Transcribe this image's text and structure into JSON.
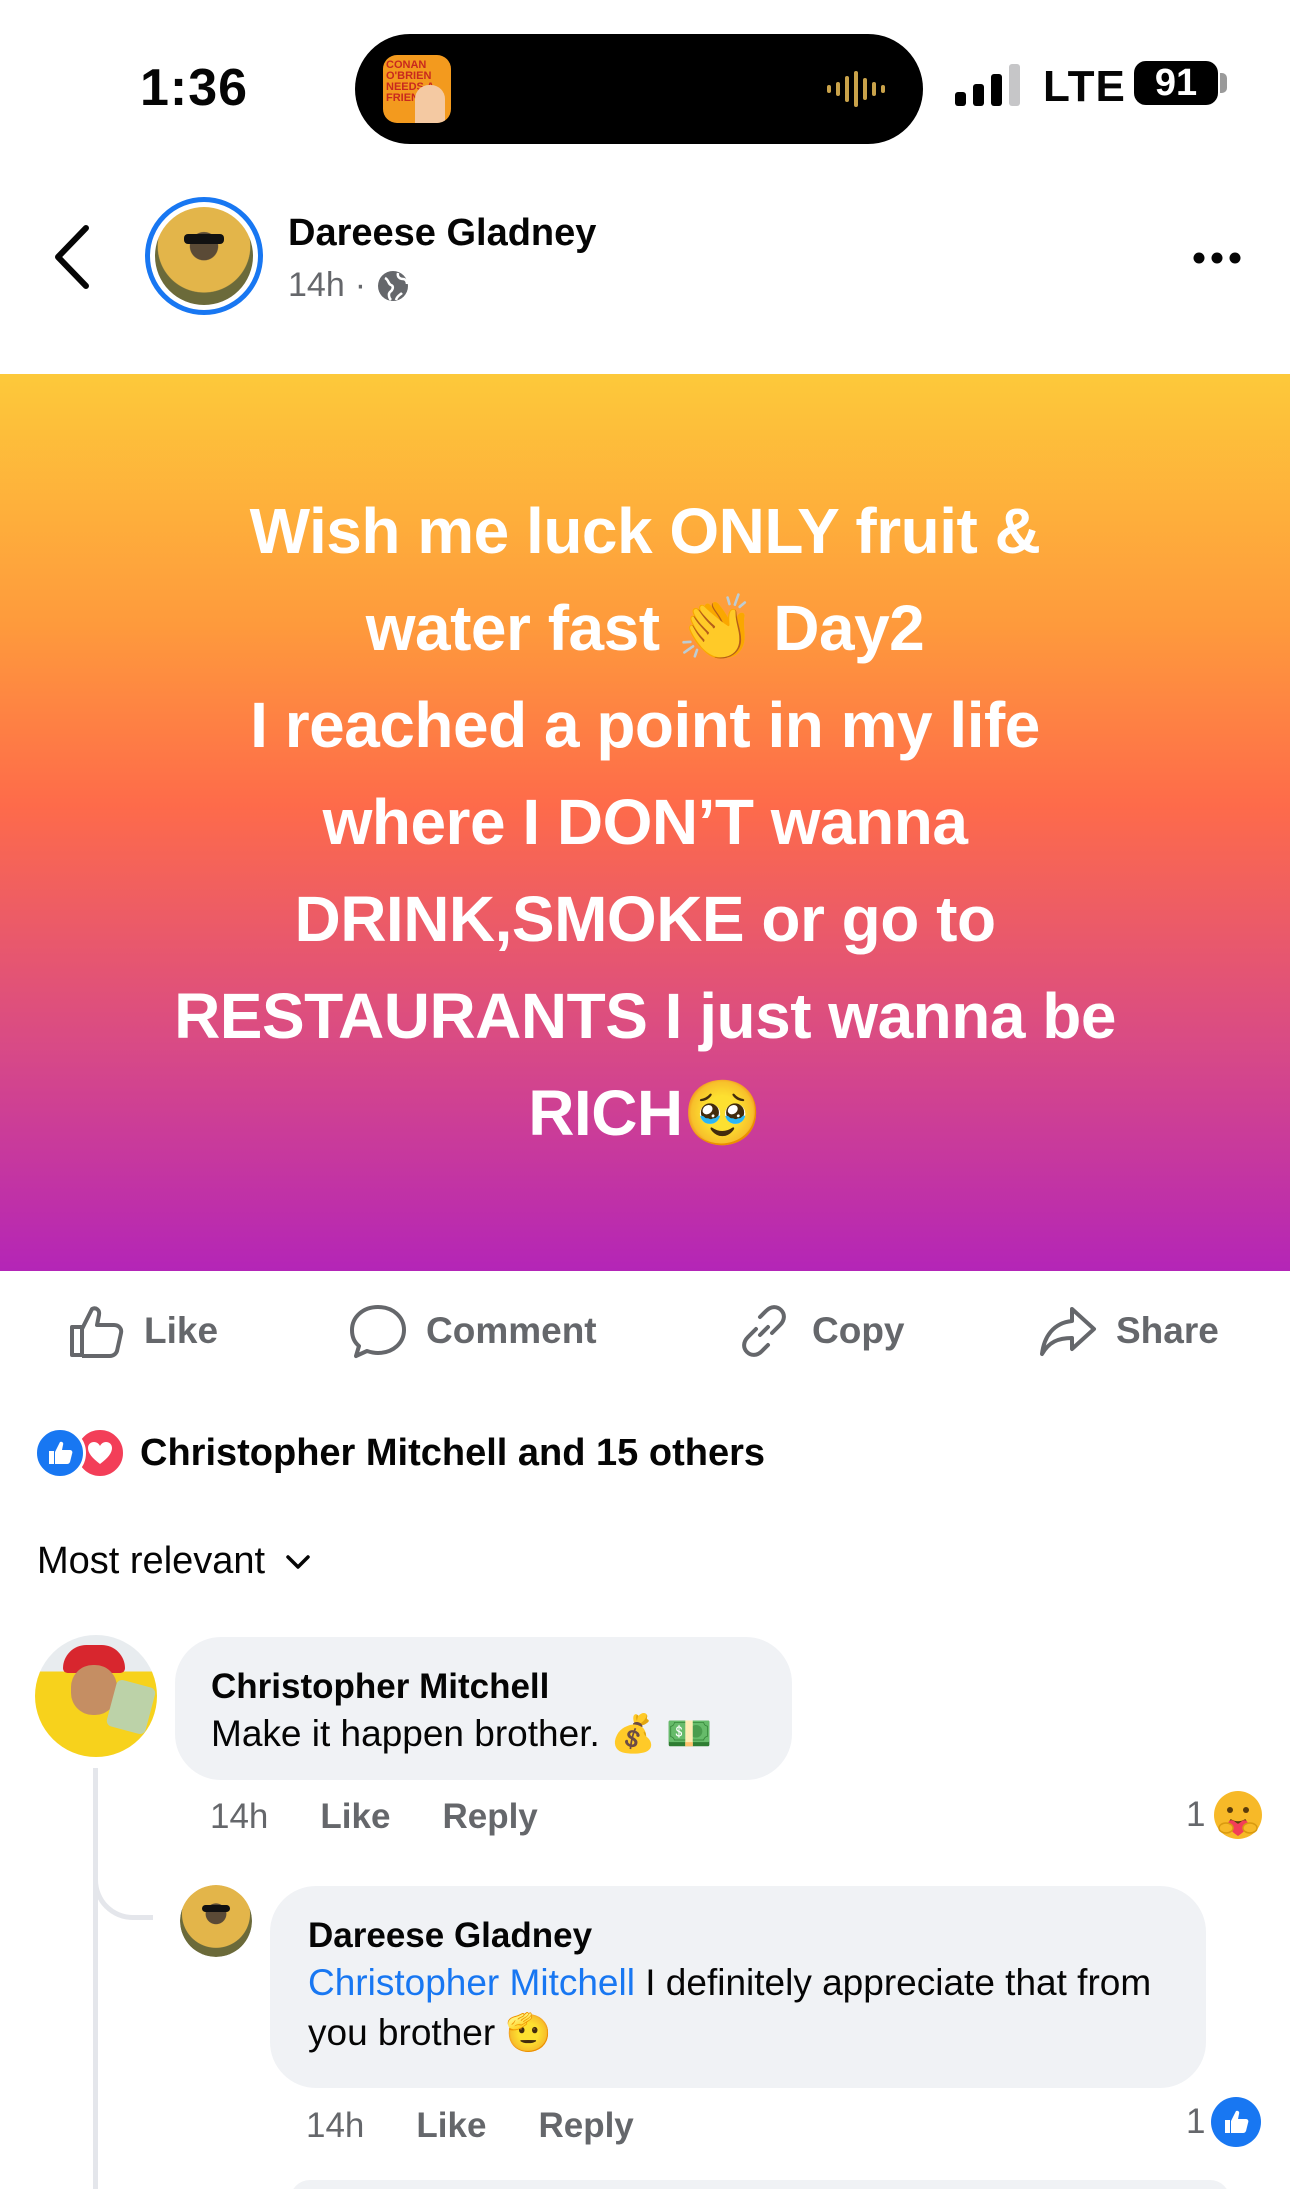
{
  "status_bar": {
    "time": "1:36",
    "network": "LTE",
    "battery": "91",
    "now_playing_art_text": "CONAN O'BRIEN NEEDS A FRIEND"
  },
  "header": {
    "author": "Dareese Gladney",
    "time": "14h",
    "separator": "·",
    "privacy_icon": "globe-icon",
    "back_icon": "chevron-left-icon",
    "more_icon": "more-horizontal-icon"
  },
  "post": {
    "lines": [
      "Wish me luck ONLY fruit &",
      "water fast 👏 Day2",
      "I reached a point in my life",
      "where I DON’T wanna",
      "DRINK,SMOKE or go to",
      "RESTAURANTS I just wanna be",
      "RICH🥹"
    ],
    "gradient": [
      "#fdc93a",
      "#fe9a3c",
      "#fe6b4a",
      "#d84a86",
      "#b425b7"
    ]
  },
  "actions": {
    "like": "Like",
    "comment": "Comment",
    "copy": "Copy",
    "share": "Share"
  },
  "reactions": {
    "summary": "Christopher Mitchell and 15 others",
    "types": [
      "like",
      "love"
    ]
  },
  "sort": {
    "label": "Most relevant"
  },
  "comments": [
    {
      "author": "Christopher Mitchell",
      "text": "Make it happen brother. 💰 💵",
      "time": "14h",
      "like": "Like",
      "reply": "Reply",
      "reaction_count": "1",
      "reaction_icon": "care-emoji-icon"
    },
    {
      "author": "Dareese Gladney",
      "mention": "Christopher Mitchell",
      "text": " I definitely appreciate that from you brother 🫡",
      "time": "14h",
      "like": "Like",
      "reply": "Reply",
      "reaction_count": "1",
      "reaction_icon": "like-icon"
    }
  ],
  "colors": {
    "accent": "#1877f2",
    "love": "#f33e58",
    "muted": "#65676b",
    "bubble": "#f0f2f5"
  }
}
